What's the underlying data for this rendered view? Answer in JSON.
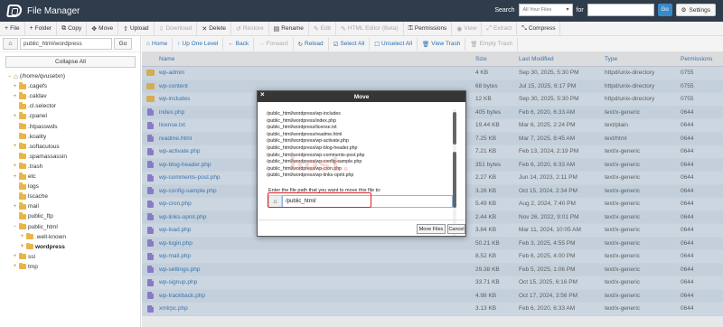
{
  "header": {
    "title": "File Manager",
    "search_label": "Search",
    "search_scope": "All Your Files",
    "for_label": "for",
    "go_label": "Go",
    "settings_label": "Settings"
  },
  "toolbar": {
    "file": "File",
    "folder": "Folder",
    "copy": "Copy",
    "move": "Move",
    "upload": "Upload",
    "download": "Download",
    "delete": "Delete",
    "restore": "Restore",
    "rename": "Rename",
    "edit": "Edit",
    "html_editor": "HTML Editor (Beta)",
    "permissions": "Permissions",
    "view": "View",
    "extract": "Extract",
    "compress": "Compress"
  },
  "left": {
    "path_value": "public_html/wordpress",
    "go_label": "Go",
    "collapse_label": "Collapse All",
    "tree": [
      {
        "label": "(/home/qvusetxn)",
        "toggle": "−",
        "icon": "home",
        "depth": 0
      },
      {
        "label": ".cagefs",
        "toggle": "+",
        "icon": "folder",
        "depth": 1
      },
      {
        "label": ".caldav",
        "toggle": "+",
        "icon": "folder",
        "depth": 1
      },
      {
        "label": ".cl.selector",
        "toggle": "",
        "icon": "folder",
        "depth": 1
      },
      {
        "label": ".cpanel",
        "toggle": "+",
        "icon": "folder",
        "depth": 1
      },
      {
        "label": ".htpasswds",
        "toggle": "",
        "icon": "folder",
        "depth": 1
      },
      {
        "label": ".koality",
        "toggle": "",
        "icon": "folder",
        "depth": 1
      },
      {
        "label": ".softaculous",
        "toggle": "+",
        "icon": "folder",
        "depth": 1
      },
      {
        "label": ".spamassassin",
        "toggle": "",
        "icon": "folder",
        "depth": 1
      },
      {
        "label": ".trash",
        "toggle": "+",
        "icon": "folder",
        "depth": 1
      },
      {
        "label": "etc",
        "toggle": "+",
        "icon": "folder",
        "depth": 1
      },
      {
        "label": "logs",
        "toggle": "",
        "icon": "folder",
        "depth": 1
      },
      {
        "label": "lscache",
        "toggle": "",
        "icon": "folder",
        "depth": 1
      },
      {
        "label": "mail",
        "toggle": "+",
        "icon": "folder",
        "depth": 1
      },
      {
        "label": "public_ftp",
        "toggle": "",
        "icon": "folder",
        "depth": 1
      },
      {
        "label": "public_html",
        "toggle": "−",
        "icon": "folder",
        "depth": 1
      },
      {
        "label": ".well-known",
        "toggle": "+",
        "icon": "folder",
        "depth": 2
      },
      {
        "label": "wordpress",
        "toggle": "+",
        "icon": "folder",
        "depth": 2,
        "bold": true
      },
      {
        "label": "ssl",
        "toggle": "+",
        "icon": "folder",
        "depth": 1
      },
      {
        "label": "tmp",
        "toggle": "+",
        "icon": "folder",
        "depth": 1
      }
    ]
  },
  "nav": {
    "home": "Home",
    "up": "Up One Level",
    "back": "Back",
    "forward": "Forward",
    "reload": "Reload",
    "select_all": "Select All",
    "unselect_all": "Unselect All",
    "view_trash": "View Trash",
    "empty_trash": "Empty Trash"
  },
  "table": {
    "headers": {
      "name": "Name",
      "size": "Size",
      "modified": "Last Modified",
      "type": "Type",
      "permissions": "Permissions"
    },
    "rows": [
      {
        "kind": "folder",
        "name": "wp-admin",
        "size": "4 KB",
        "modified": "Sep 30, 2025, 5:30 PM",
        "type": "httpd/unix-directory",
        "perm": "0755"
      },
      {
        "kind": "folder",
        "name": "wp-content",
        "size": "68 bytes",
        "modified": "Jul 15, 2025, 6:17 PM",
        "type": "httpd/unix-directory",
        "perm": "0755"
      },
      {
        "kind": "folder",
        "name": "wp-includes",
        "size": "12 KB",
        "modified": "Sep 30, 2025, 5:30 PM",
        "type": "httpd/unix-directory",
        "perm": "0755"
      },
      {
        "kind": "file",
        "name": "index.php",
        "size": "405 bytes",
        "modified": "Feb 6, 2020, 6:33 AM",
        "type": "text/x-generic",
        "perm": "0644"
      },
      {
        "kind": "file",
        "name": "license.txt",
        "size": "19.44 KB",
        "modified": "Mar 6, 2025, 2:24 PM",
        "type": "text/plain",
        "perm": "0644"
      },
      {
        "kind": "file",
        "name": "readme.html",
        "size": "7.25 KB",
        "modified": "Mar 7, 2025, 8:45 AM",
        "type": "text/html",
        "perm": "0644"
      },
      {
        "kind": "file",
        "name": "wp-activate.php",
        "size": "7.21 KB",
        "modified": "Feb 13, 2024, 2:19 PM",
        "type": "text/x-generic",
        "perm": "0644"
      },
      {
        "kind": "file",
        "name": "wp-blog-header.php",
        "size": "351 bytes",
        "modified": "Feb 6, 2020, 6:33 AM",
        "type": "text/x-generic",
        "perm": "0644"
      },
      {
        "kind": "file",
        "name": "wp-comments-post.php",
        "size": "2.27 KB",
        "modified": "Jun 14, 2023, 2:11 PM",
        "type": "text/x-generic",
        "perm": "0644"
      },
      {
        "kind": "file",
        "name": "wp-config-sample.php",
        "size": "3.26 KB",
        "modified": "Oct 15, 2024, 2:34 PM",
        "type": "text/x-generic",
        "perm": "0644"
      },
      {
        "kind": "file",
        "name": "wp-cron.php",
        "size": "5.49 KB",
        "modified": "Aug 2, 2024, 7:40 PM",
        "type": "text/x-generic",
        "perm": "0644"
      },
      {
        "kind": "file",
        "name": "wp-links-opml.php",
        "size": "2.44 KB",
        "modified": "Nov 26, 2022, 9:01 PM",
        "type": "text/x-generic",
        "perm": "0644"
      },
      {
        "kind": "file",
        "name": "wp-load.php",
        "size": "3.84 KB",
        "modified": "Mar 11, 2024, 10:05 AM",
        "type": "text/x-generic",
        "perm": "0644"
      },
      {
        "kind": "file",
        "name": "wp-login.php",
        "size": "50.21 KB",
        "modified": "Feb 3, 2025, 4:55 PM",
        "type": "text/x-generic",
        "perm": "0644"
      },
      {
        "kind": "file",
        "name": "wp-mail.php",
        "size": "8.52 KB",
        "modified": "Feb 6, 2025, 4:00 PM",
        "type": "text/x-generic",
        "perm": "0644"
      },
      {
        "kind": "file",
        "name": "wp-settings.php",
        "size": "29.38 KB",
        "modified": "Feb 5, 2025, 1:06 PM",
        "type": "text/x-generic",
        "perm": "0644"
      },
      {
        "kind": "file",
        "name": "wp-signup.php",
        "size": "33.71 KB",
        "modified": "Oct 15, 2025, 6:16 PM",
        "type": "text/x-generic",
        "perm": "0644"
      },
      {
        "kind": "file",
        "name": "wp-trackback.php",
        "size": "4.98 KB",
        "modified": "Oct 17, 2024, 3:56 PM",
        "type": "text/x-generic",
        "perm": "0644"
      },
      {
        "kind": "file",
        "name": "xmlrpc.php",
        "size": "3.13 KB",
        "modified": "Feb 6, 2020, 6:33 AM",
        "type": "text/x-generic",
        "perm": "0644"
      }
    ]
  },
  "dialog": {
    "title": "Move",
    "close": "×",
    "files": [
      "/public_html/wordpress/wp-includes",
      "/public_html/wordpress/index.php",
      "/public_html/wordpress/license.txt",
      "/public_html/wordpress/readme.html",
      "/public_html/wordpress/wp-activate.php",
      "/public_html/wordpress/wp-blog-header.php",
      "/public_html/wordpress/wp-comments-post.php",
      "/public_html/wordpress/wp-config-sample.php",
      "/public_html/wordpress/wp-cron.php",
      "/public_html/wordpress/wp-links-opml.php"
    ],
    "prompt": "Enter the file path that you want to move this file to:",
    "path_value": "/public_html/",
    "move_button": "Move Files",
    "cancel_button": "Cancel"
  },
  "watermark": "host."
}
